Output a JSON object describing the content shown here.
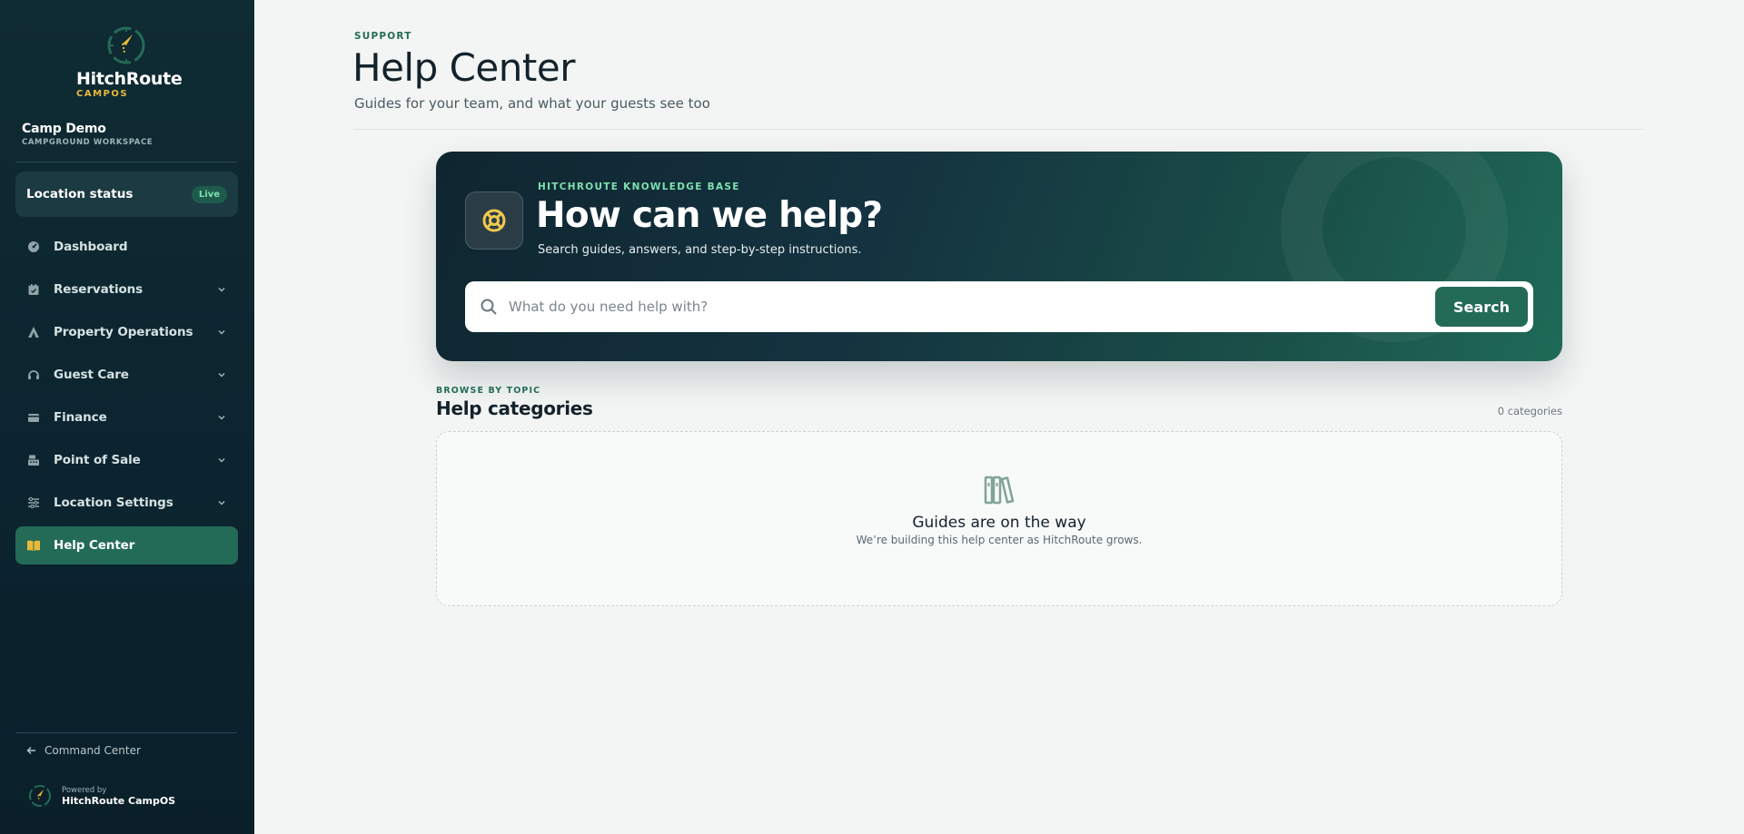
{
  "brand": {
    "name": "HitchRoute",
    "sub": "CAMPOS"
  },
  "workspace": {
    "name": "Camp Demo",
    "sub": "CAMPGROUND WORKSPACE"
  },
  "location_status": {
    "label": "Location status",
    "badge": "Live"
  },
  "nav": {
    "items": [
      {
        "label": "Dashboard",
        "icon": "dashboard-icon"
      },
      {
        "label": "Reservations",
        "icon": "calendar-icon"
      },
      {
        "label": "Property Operations",
        "icon": "tent-icon"
      },
      {
        "label": "Guest Care",
        "icon": "headset-icon"
      },
      {
        "label": "Finance",
        "icon": "wallet-icon"
      },
      {
        "label": "Point of Sale",
        "icon": "register-icon"
      },
      {
        "label": "Location Settings",
        "icon": "sliders-icon"
      },
      {
        "label": "Help Center",
        "icon": "book-icon"
      }
    ],
    "active": "Help Center"
  },
  "footer": {
    "command_center": "Command Center",
    "powered_small": "Powered by",
    "powered_name": "HitchRoute CampOS"
  },
  "header": {
    "eyebrow": "SUPPORT",
    "title": "Help Center",
    "subtitle": "Guides for your team, and what your guests see too"
  },
  "hero": {
    "eyebrow": "HITCHROUTE KNOWLEDGE BASE",
    "title": "How can we help?",
    "subtitle": "Search guides, answers, and step-by-step instructions.",
    "search_placeholder": "What do you need help with?",
    "search_button": "Search"
  },
  "browse": {
    "eyebrow": "BROWSE BY TOPIC",
    "title": "Help categories",
    "count": "0 categories"
  },
  "empty_state": {
    "title": "Guides are on the way",
    "subtitle": "We’re building this help center as HitchRoute grows."
  },
  "colors": {
    "sidebar_bg": "#0c2530",
    "accent": "#236b57",
    "brand_yellow": "#e9b93a",
    "live_green": "#7ee0b0"
  }
}
